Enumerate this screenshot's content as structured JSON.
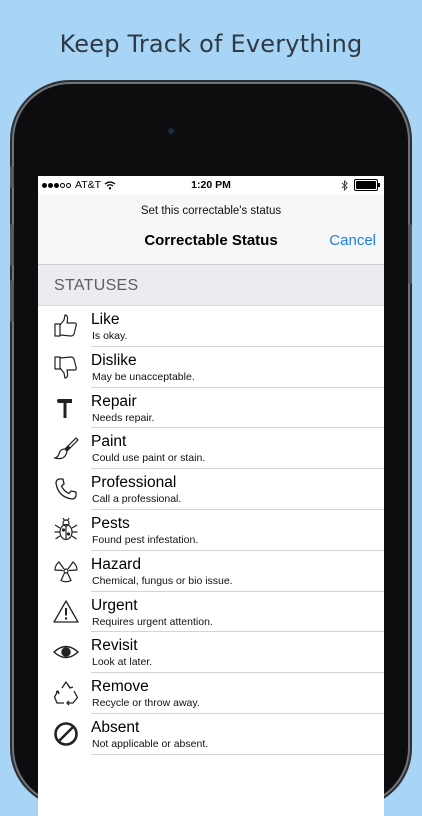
{
  "headline": "Keep Track of Everything",
  "status_bar": {
    "carrier": "AT&T",
    "time": "1:20 PM",
    "signal_icon": "signal-dots-icon",
    "wifi_icon": "wifi-icon",
    "bluetooth_icon": "bluetooth-icon",
    "battery_icon": "battery-icon"
  },
  "nav": {
    "prompt": "Set this correctable's status",
    "title": "Correctable Status",
    "cancel_label": "Cancel"
  },
  "section_header": "STATUSES",
  "colors": {
    "background": "#a8d4f6",
    "accent": "#1f7fe0",
    "section_bg": "#ececf0"
  },
  "statuses": [
    {
      "title": "Like",
      "subtitle": "Is okay.",
      "icon": "thumbs-up-icon"
    },
    {
      "title": "Dislike",
      "subtitle": "May be unacceptable.",
      "icon": "thumbs-down-icon"
    },
    {
      "title": "Repair",
      "subtitle": "Needs repair.",
      "icon": "hammer-icon"
    },
    {
      "title": "Paint",
      "subtitle": "Could use paint or stain.",
      "icon": "paintbrush-icon"
    },
    {
      "title": "Professional",
      "subtitle": "Call a professional.",
      "icon": "phone-icon"
    },
    {
      "title": "Pests",
      "subtitle": "Found pest infestation.",
      "icon": "bug-icon"
    },
    {
      "title": "Hazard",
      "subtitle": "Chemical, fungus or bio issue.",
      "icon": "radiation-icon"
    },
    {
      "title": "Urgent",
      "subtitle": "Requires urgent attention.",
      "icon": "warning-icon"
    },
    {
      "title": "Revisit",
      "subtitle": "Look at later.",
      "icon": "eye-icon"
    },
    {
      "title": "Remove",
      "subtitle": "Recycle or throw away.",
      "icon": "recycle-icon"
    },
    {
      "title": "Absent",
      "subtitle": "Not applicable or absent.",
      "icon": "prohibited-icon"
    }
  ]
}
